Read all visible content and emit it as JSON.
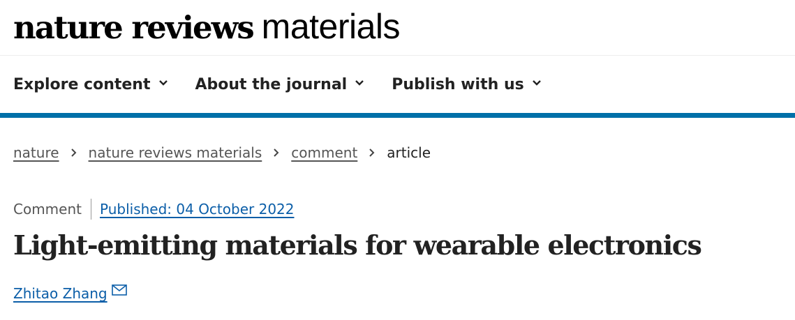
{
  "site": {
    "logo_bold": "nature reviews",
    "logo_light": "materials"
  },
  "nav": {
    "items": [
      {
        "label": "Explore content",
        "icon": "chevron-down-icon"
      },
      {
        "label": "About the journal",
        "icon": "chevron-down-icon"
      },
      {
        "label": "Publish with us",
        "icon": "chevron-down-icon"
      }
    ],
    "accent_color": "#0070a8"
  },
  "breadcrumb": {
    "items": [
      {
        "label": "nature",
        "link": true
      },
      {
        "label": "nature reviews materials",
        "link": true
      },
      {
        "label": "comment",
        "link": true
      },
      {
        "label": "article",
        "link": false
      }
    ],
    "separator_icon": "chevron-right-icon"
  },
  "article": {
    "type": "Comment",
    "published": "Published: 04 October 2022",
    "title": "Light-emitting materials for wearable electronics",
    "author": "Zhitao Zhang",
    "author_icon": "mail-icon",
    "link_color": "#0b5ea8"
  }
}
